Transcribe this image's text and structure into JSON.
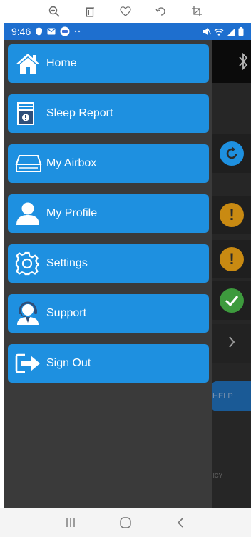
{
  "viewer_toolbar": {
    "icons": [
      "zoom-in-icon",
      "trash-icon",
      "heart-icon",
      "rotate-icon",
      "crop-icon"
    ]
  },
  "status_bar": {
    "time": "9:46",
    "left_icons": [
      "shield-icon",
      "mail-icon",
      "app-badge-icon",
      "more-dots-icon"
    ],
    "right_icons": [
      "mute-icon",
      "wifi-icon",
      "signal-icon",
      "battery-icon"
    ]
  },
  "drawer": {
    "items": [
      {
        "label": "Home",
        "icon": "home-icon"
      },
      {
        "label": "Sleep Report",
        "icon": "report-icon"
      },
      {
        "label": "My Airbox",
        "icon": "airbox-icon"
      },
      {
        "label": "My Profile",
        "icon": "profile-icon"
      },
      {
        "label": "Settings",
        "icon": "gear-icon"
      },
      {
        "label": "Support",
        "icon": "support-icon"
      },
      {
        "label": "Sign Out",
        "icon": "sign-out-icon"
      }
    ]
  },
  "background": {
    "help_label": "HELP",
    "footer_fragment": "ICY"
  },
  "colors": {
    "menu_item": "#1e90e0",
    "status_bar": "#1e6fcf",
    "drawer_bg": "#3a3a3a",
    "refresh": "#1e90e0",
    "warning": "#c98a12",
    "success": "#3d9a3d"
  },
  "nav_bar": {
    "buttons": [
      "recent-apps-icon",
      "home-circle-icon",
      "back-icon"
    ]
  }
}
